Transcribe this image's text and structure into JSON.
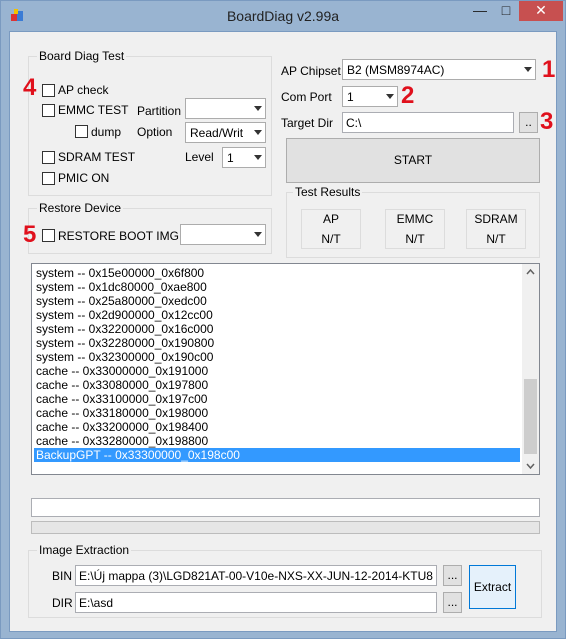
{
  "window": {
    "title": "BoardDiag v2.99a"
  },
  "board_diag": {
    "group_label": "Board Diag Test",
    "ap_check": "AP check",
    "emmc_test": "EMMC TEST",
    "partition_label": "Partition",
    "partition_value": "",
    "dump_label": "dump",
    "option_label": "Option",
    "option_value": "Read/Writ",
    "sdram_test": "SDRAM TEST",
    "level_label": "Level",
    "level_value": "1",
    "pmic_on": "PMIC ON"
  },
  "restore": {
    "group_label": "Restore Device",
    "restore_boot_img": "RESTORE BOOT IMG",
    "img_value": ""
  },
  "settings": {
    "ap_chipset_label": "AP Chipset",
    "ap_chipset_value": "B2 (MSM8974AC)",
    "com_port_label": "Com Port",
    "com_port_value": "1",
    "target_dir_label": "Target Dir",
    "target_dir_value": "C:\\",
    "browse_label": "..",
    "start_label": "START"
  },
  "results": {
    "group_label": "Test Results",
    "items": [
      {
        "name": "AP",
        "value": "N/T"
      },
      {
        "name": "EMMC",
        "value": "N/T"
      },
      {
        "name": "SDRAM",
        "value": "N/T"
      }
    ]
  },
  "annotations": [
    "1",
    "2",
    "3",
    "4",
    "5"
  ],
  "log": {
    "items": [
      "system -- 0x15e00000_0x6f800",
      "system -- 0x1dc80000_0xae800",
      "system -- 0x25a80000_0xedc00",
      "system -- 0x2d900000_0x12cc00",
      "system -- 0x32200000_0x16c000",
      "system -- 0x32280000_0x190800",
      "system -- 0x32300000_0x190c00",
      "cache -- 0x33000000_0x191000",
      "cache -- 0x33080000_0x197800",
      "cache -- 0x33100000_0x197c00",
      "cache -- 0x33180000_0x198000",
      "cache -- 0x33200000_0x198400",
      "cache -- 0x33280000_0x198800",
      "BackupGPT -- 0x33300000_0x198c00"
    ],
    "selected_index": 13
  },
  "status": {
    "text": "",
    "progress": 0
  },
  "extraction": {
    "group_label": "Image Extraction",
    "bin_label": "BIN",
    "bin_value": "E:\\Új mappa (3)\\LGD821AT-00-V10e-NXS-XX-JUN-12-2014-KTU8",
    "dir_label": "DIR",
    "dir_value": "E:\\asd",
    "browse_label": "...",
    "extract_label": "Extract"
  },
  "colors": {
    "accent_red": "#e0101c",
    "selection": "#3399ff",
    "title_bar": "#99b4d1"
  }
}
